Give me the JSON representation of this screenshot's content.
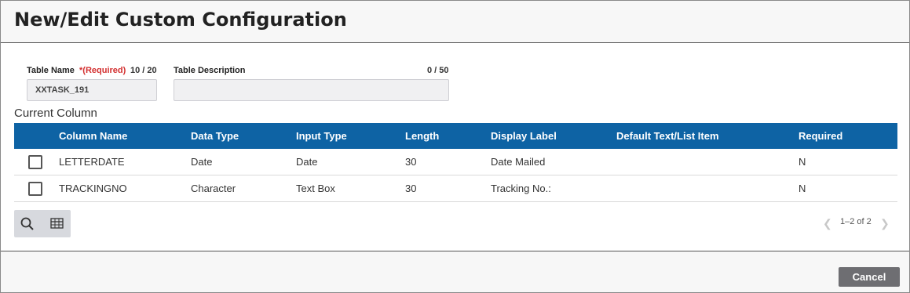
{
  "dialog": {
    "title": "New/Edit Custom Configuration"
  },
  "form": {
    "table_name": {
      "label": "Table Name",
      "required_mark": "*",
      "required_text": "(Required)",
      "counter": "10 / 20",
      "value": "XXTASK_191"
    },
    "table_description": {
      "label": "Table Description",
      "counter": "0 / 50",
      "value": ""
    }
  },
  "section": {
    "title": "Current Column"
  },
  "table": {
    "columns": [
      "Column Name",
      "Data Type",
      "Input Type",
      "Length",
      "Display Label",
      "Default Text/List Item",
      "Required"
    ],
    "rows": [
      [
        "LETTERDATE",
        "Date",
        "Date",
        "30",
        "Date Mailed",
        "",
        "N"
      ],
      [
        "TRACKINGNO",
        "Character",
        "Text Box",
        "30",
        "Tracking No.:",
        "",
        "N"
      ]
    ]
  },
  "toolbar": {
    "search_icon": "search-icon",
    "columns_icon": "table-columns-icon"
  },
  "pager": {
    "range": "1–2 of 2",
    "prev_icon": "chevron-left-icon",
    "next_icon": "chevron-right-icon"
  },
  "footer": {
    "cancel_label": "Cancel"
  },
  "colors": {
    "header_blue": "#0e63a4",
    "required_red": "#d32f2f",
    "cancel_gray": "#6e6e72"
  }
}
